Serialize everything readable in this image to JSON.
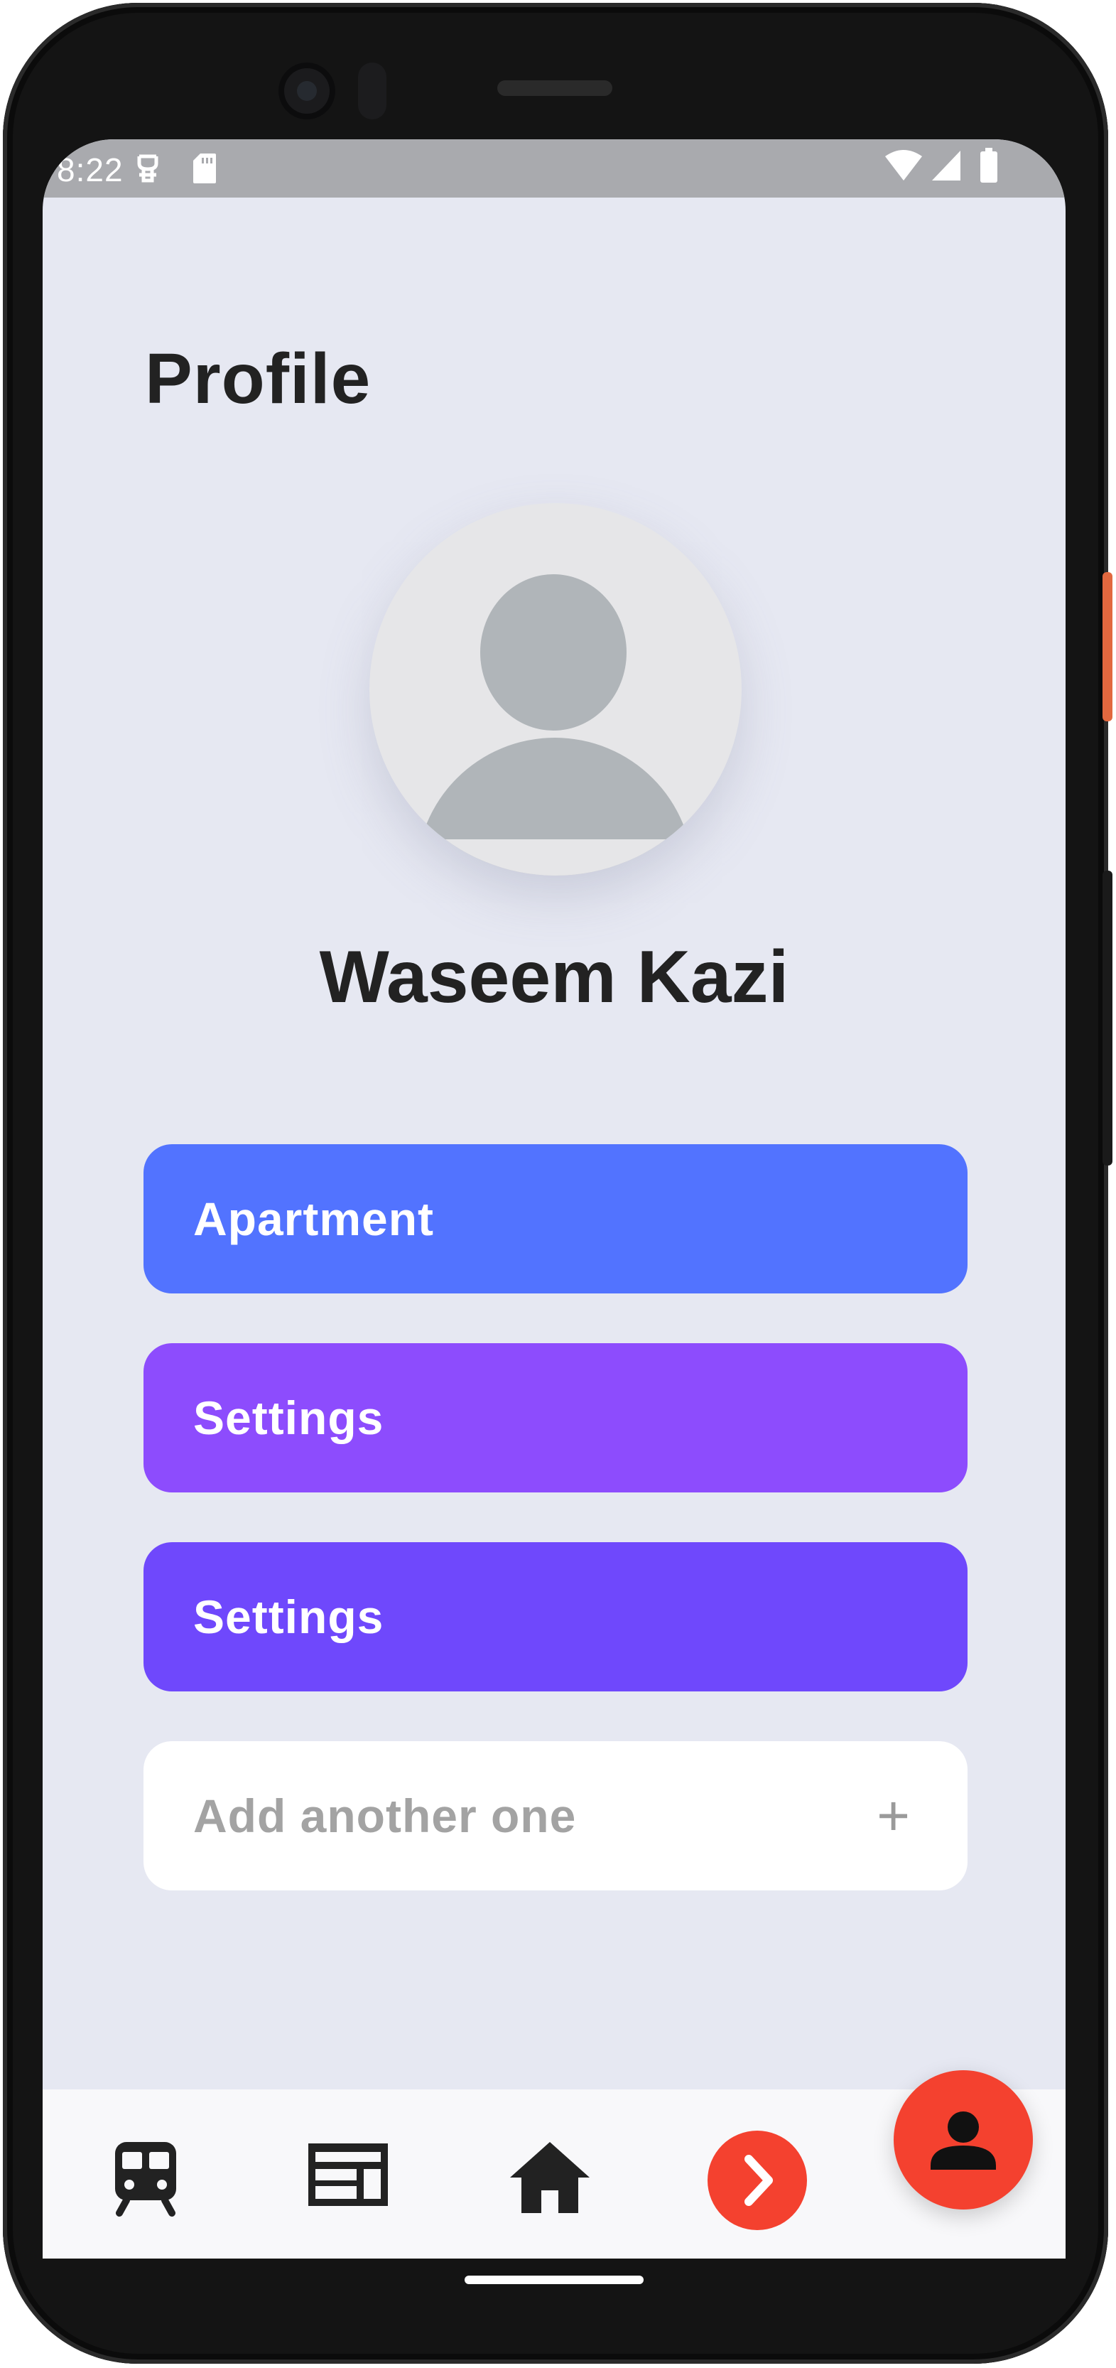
{
  "status_bar": {
    "time": "8:22",
    "icons": [
      "notification-icon",
      "sd-card-icon",
      "wifi-icon",
      "signal-icon",
      "battery-icon"
    ]
  },
  "page": {
    "title": "Profile"
  },
  "profile": {
    "name": "Waseem Kazi",
    "avatar_icon": "person-placeholder-icon"
  },
  "menu": {
    "items": [
      {
        "label": "Apartment",
        "color": "#5273ff"
      },
      {
        "label": "Settings",
        "color": "#8d4cfd"
      },
      {
        "label": "Settings",
        "color": "#6f48fc"
      }
    ],
    "add": {
      "label": "Add another one",
      "icon": "plus-icon",
      "glyph": "+"
    }
  },
  "bottom_nav": {
    "items": [
      {
        "icon": "train-icon"
      },
      {
        "icon": "news-icon"
      },
      {
        "icon": "home-icon"
      },
      {
        "icon": "chevron-right-icon",
        "color": "#f4412f"
      }
    ],
    "fab": {
      "icon": "person-icon",
      "color": "#f4412f"
    }
  }
}
